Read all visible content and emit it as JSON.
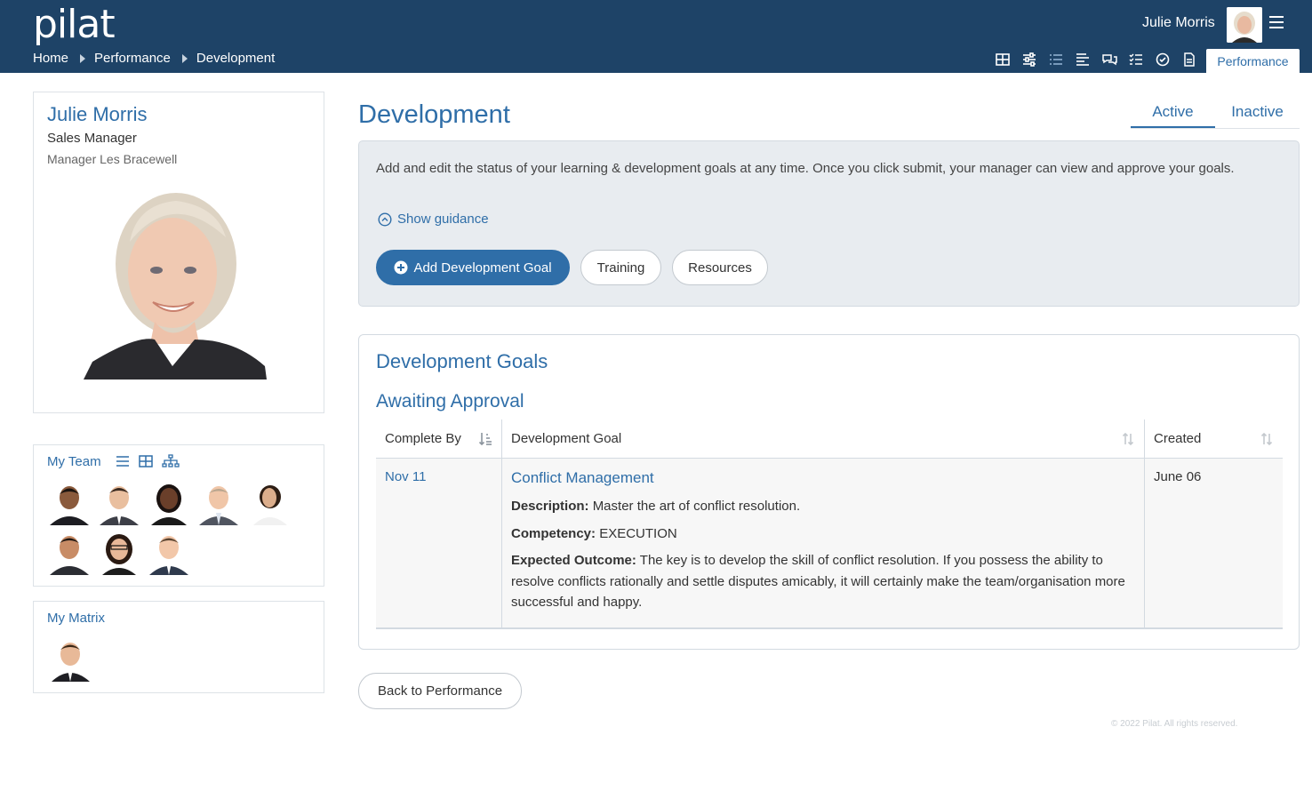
{
  "app": {
    "logo": "pilat"
  },
  "breadcrumb": [
    "Home",
    "Performance",
    "Development"
  ],
  "header": {
    "user_name": "Julie Morris",
    "toolbar_icons": [
      "grid-icon",
      "sliders-icon",
      "list-icon",
      "align-left-icon",
      "chat-icon",
      "checklist-icon",
      "check-circle-icon",
      "document-icon"
    ],
    "active_section": "Performance"
  },
  "profile": {
    "name": "Julie Morris",
    "role": "Sales Manager",
    "manager": "Manager Les Bracewell"
  },
  "team": {
    "title": "My Team",
    "view_icons": [
      "list-view-icon",
      "grid-view-icon",
      "org-chart-icon"
    ],
    "member_count": 8
  },
  "matrix": {
    "title": "My Matrix",
    "member_count": 1
  },
  "page": {
    "title": "Development",
    "tabs": [
      {
        "label": "Active",
        "active": true
      },
      {
        "label": "Inactive",
        "active": false
      }
    ]
  },
  "intro": {
    "text": "Add and edit the status of your learning & development goals at any time. Once you click submit, your manager can view and approve your goals.",
    "guidance_label": "Show guidance",
    "add_goal_label": "Add Development Goal",
    "training_label": "Training",
    "resources_label": "Resources"
  },
  "goals": {
    "title": "Development Goals",
    "group_title": "Awaiting Approval",
    "columns": [
      "Complete By",
      "Development Goal",
      "Created"
    ],
    "rows": [
      {
        "complete_by": "Nov 11",
        "goal": "Conflict Management",
        "description_label": "Description:",
        "description": "Master the art of conflict resolution.",
        "competency_label": "Competency:",
        "competency": "EXECUTION",
        "outcome_label": "Expected Outcome:",
        "outcome": "The key is to develop the skill of conflict resolution. If you possess the ability to resolve conflicts rationally and settle disputes amicably, it will certainly make the team/organisation more successful and happy.",
        "created": "June 06"
      }
    ]
  },
  "back_label": "Back to Performance",
  "footer": "© 2022 Pilat. All rights reserved.",
  "colors": {
    "header_bg": "#1e4367",
    "accent": "#2f6ea8",
    "panel_bg": "#e8ecf0"
  }
}
